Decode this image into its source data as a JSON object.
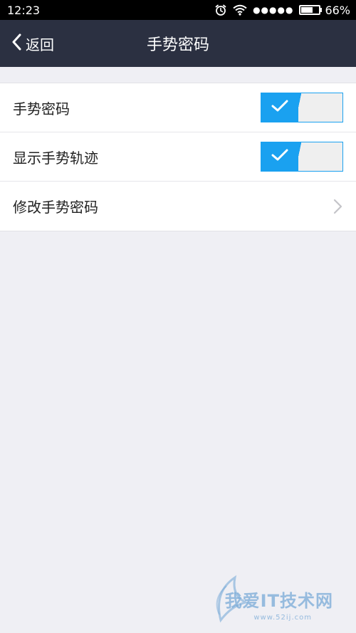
{
  "status_bar": {
    "time": "12:23",
    "signal_dots": "●●●●●",
    "battery_percent": "66%",
    "battery_level": 0.66
  },
  "nav": {
    "back_label": "返回",
    "title": "手势密码"
  },
  "settings": {
    "gesture_password_label": "手势密码",
    "gesture_password_enabled": true,
    "show_gesture_trail_label": "显示手势轨迹",
    "show_gesture_trail_enabled": true,
    "change_gesture_password_label": "修改手势密码"
  },
  "watermark": {
    "title": "我爱IT技术网",
    "url": "www.52ij.com"
  },
  "colors": {
    "accent": "#1aa1f0",
    "nav_background": "#2b3041",
    "page_background": "#efeff4"
  }
}
